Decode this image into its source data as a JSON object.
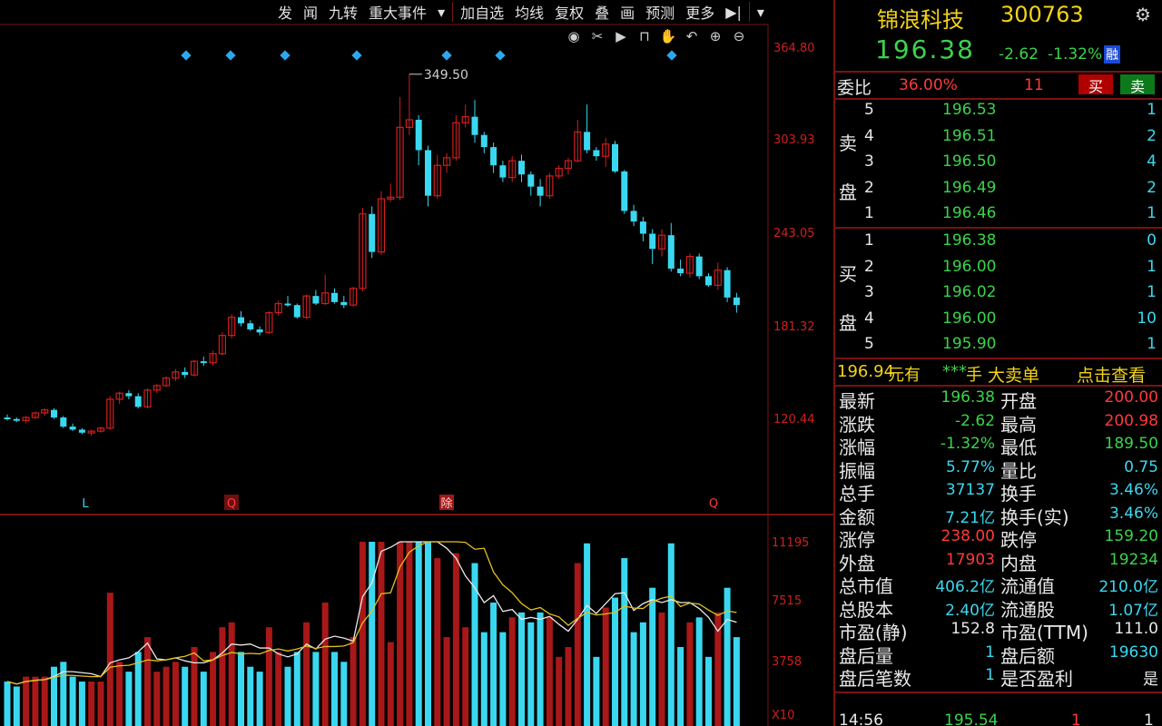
{
  "toolbar": {
    "items": [
      "发",
      "闻",
      "九转",
      "重大事件",
      "▾",
      "加自选",
      "均线",
      "复权",
      "叠",
      "画",
      "预测",
      "更多",
      "▶|",
      "▾"
    ]
  },
  "tool_icons": [
    "eye-icon",
    "scissors-icon",
    "play-icon",
    "lock-icon",
    "hand-icon",
    "undo-icon",
    "zoom-in-icon",
    "zoom-out-icon"
  ],
  "chart": {
    "price_axis": [
      "364.80",
      "303.93",
      "243.05",
      "181.32",
      "120.44"
    ],
    "volume_axis": [
      "11195",
      "7515",
      "3758",
      "X10"
    ],
    "peak_label": "349.50",
    "markers": [
      "L",
      "Q",
      "除",
      "Q"
    ]
  },
  "chart_data": {
    "type": "candlestick",
    "candles": [
      [
        124,
        126,
        122,
        123
      ],
      [
        123,
        124,
        121,
        122
      ],
      [
        122,
        125,
        120,
        124
      ],
      [
        124,
        128,
        123,
        127
      ],
      [
        127,
        130,
        125,
        129
      ],
      [
        129,
        130,
        123,
        124
      ],
      [
        124,
        125,
        117,
        118
      ],
      [
        118,
        120,
        115,
        116
      ],
      [
        116,
        117,
        113,
        114
      ],
      [
        114,
        116,
        112,
        115
      ],
      [
        115,
        118,
        114,
        117
      ],
      [
        117,
        138,
        116,
        136
      ],
      [
        136,
        141,
        133,
        140
      ],
      [
        140,
        142,
        136,
        138
      ],
      [
        138,
        140,
        130,
        131
      ],
      [
        131,
        143,
        130,
        142
      ],
      [
        142,
        146,
        140,
        145
      ],
      [
        145,
        151,
        144,
        150
      ],
      [
        150,
        156,
        148,
        154
      ],
      [
        154,
        157,
        150,
        152
      ],
      [
        152,
        162,
        151,
        161
      ],
      [
        161,
        164,
        158,
        160
      ],
      [
        160,
        168,
        158,
        166
      ],
      [
        166,
        180,
        165,
        178
      ],
      [
        178,
        192,
        176,
        190
      ],
      [
        190,
        194,
        184,
        186
      ],
      [
        186,
        188,
        181,
        182
      ],
      [
        182,
        184,
        178,
        180
      ],
      [
        180,
        194,
        179,
        193
      ],
      [
        193,
        201,
        191,
        199
      ],
      [
        199,
        204,
        197,
        198
      ],
      [
        198,
        199,
        189,
        190
      ],
      [
        190,
        205,
        189,
        204
      ],
      [
        204,
        208,
        198,
        199
      ],
      [
        199,
        218,
        198,
        206
      ],
      [
        206,
        209,
        199,
        200
      ],
      [
        200,
        204,
        196,
        198
      ],
      [
        198,
        210,
        197,
        209
      ],
      [
        209,
        262,
        207,
        258
      ],
      [
        258,
        263,
        229,
        233
      ],
      [
        233,
        273,
        231,
        268
      ],
      [
        268,
        278,
        266,
        269
      ],
      [
        269,
        335,
        267,
        315
      ],
      [
        315,
        350,
        310,
        320
      ],
      [
        320,
        323,
        290,
        300
      ],
      [
        300,
        303,
        263,
        270
      ],
      [
        270,
        297,
        268,
        290
      ],
      [
        290,
        298,
        285,
        295
      ],
      [
        295,
        323,
        293,
        318
      ],
      [
        318,
        330,
        315,
        322
      ],
      [
        322,
        333,
        305,
        310
      ],
      [
        310,
        312,
        298,
        302
      ],
      [
        302,
        305,
        285,
        290
      ],
      [
        290,
        293,
        279,
        282
      ],
      [
        282,
        296,
        279,
        293
      ],
      [
        293,
        297,
        279,
        284
      ],
      [
        284,
        286,
        270,
        276
      ],
      [
        276,
        281,
        263,
        270
      ],
      [
        270,
        285,
        268,
        283
      ],
      [
        283,
        290,
        281,
        288
      ],
      [
        288,
        295,
        284,
        293
      ],
      [
        293,
        320,
        292,
        312
      ],
      [
        312,
        330,
        298,
        300
      ],
      [
        300,
        302,
        293,
        296
      ],
      [
        296,
        308,
        289,
        304
      ],
      [
        304,
        306,
        285,
        286
      ],
      [
        286,
        287,
        258,
        260
      ],
      [
        260,
        264,
        250,
        253
      ],
      [
        253,
        256,
        240,
        245
      ],
      [
        245,
        248,
        225,
        235
      ],
      [
        235,
        248,
        230,
        244
      ],
      [
        244,
        252,
        220,
        222
      ],
      [
        222,
        228,
        217,
        219
      ],
      [
        219,
        232,
        216,
        230
      ],
      [
        230,
        232,
        215,
        217
      ],
      [
        217,
        219,
        210,
        211
      ],
      [
        211,
        226,
        208,
        221
      ],
      [
        221,
        223,
        200,
        203
      ],
      [
        203,
        206,
        193,
        198
      ]
    ]
  },
  "quote": {
    "name": "锦浪科技",
    "code": "300763",
    "price": "196.38",
    "change": "-2.62",
    "change_pct": "-1.32%",
    "tag": "融",
    "weibi_label": "委比",
    "weibi_value": "36.00%",
    "weibi_diff": "11",
    "buy_btn": "买",
    "sell_btn": "卖"
  },
  "sell_orders": [
    {
      "level": "5",
      "price": "196.53",
      "vol": "1"
    },
    {
      "level": "4",
      "price": "196.51",
      "vol": "2"
    },
    {
      "level": "3",
      "price": "196.50",
      "vol": "4"
    },
    {
      "level": "2",
      "price": "196.49",
      "vol": "2"
    },
    {
      "level": "1",
      "price": "196.46",
      "vol": "1"
    }
  ],
  "buy_orders": [
    {
      "level": "1",
      "price": "196.38",
      "vol": "0"
    },
    {
      "level": "2",
      "price": "196.00",
      "vol": "1"
    },
    {
      "level": "3",
      "price": "196.02",
      "vol": "1"
    },
    {
      "level": "4",
      "price": "196.00",
      "vol": "10"
    },
    {
      "level": "5",
      "price": "195.90",
      "vol": "1"
    }
  ],
  "side_labels": {
    "sell1": "卖",
    "sell2": "盘",
    "buy1": "买",
    "buy2": "盘"
  },
  "big_order": {
    "price": "196.94",
    "text1": "元有",
    "stars": "***",
    "text2": "手",
    "title": "大卖单",
    "link": "点击查看"
  },
  "stats": [
    {
      "l": "最新",
      "v": "196.38",
      "vc": "green",
      "l2": "开盘",
      "v2": "200.00",
      "vc2": "red"
    },
    {
      "l": "涨跌",
      "v": "-2.62",
      "vc": "green",
      "l2": "最高",
      "v2": "200.98",
      "vc2": "red"
    },
    {
      "l": "涨幅",
      "v": "-1.32%",
      "vc": "green",
      "l2": "最低",
      "v2": "189.50",
      "vc2": "green"
    },
    {
      "l": "振幅",
      "v": "5.77%",
      "vc": "cyan",
      "l2": "量比",
      "v2": "0.75",
      "vc2": "cyan"
    },
    {
      "l": "总手",
      "v": "37137",
      "vc": "cyan",
      "l2": "换手",
      "v2": "3.46%",
      "vc2": "cyan"
    },
    {
      "l": "金额",
      "v": "7.21亿",
      "vc": "cyan",
      "l2": "换手(实)",
      "v2": "3.46%",
      "vc2": "cyan"
    },
    {
      "l": "涨停",
      "v": "238.00",
      "vc": "red",
      "l2": "跌停",
      "v2": "159.20",
      "vc2": "green"
    },
    {
      "l": "外盘",
      "v": "17903",
      "vc": "red",
      "l2": "内盘",
      "v2": "19234",
      "vc2": "green"
    },
    {
      "l": "总市值",
      "v": "406.2亿",
      "vc": "cyan",
      "l2": "流通值",
      "v2": "210.0亿",
      "vc2": "cyan"
    },
    {
      "l": "总股本",
      "v": "2.40亿",
      "vc": "cyan",
      "l2": "流通股",
      "v2": "1.07亿",
      "vc2": "cyan"
    },
    {
      "l": "市盈(静)",
      "v": "152.8",
      "vc": "white",
      "l2": "市盈(TTM)",
      "v2": "111.0",
      "vc2": "white"
    },
    {
      "l": "盘后量",
      "v": "1",
      "vc": "cyan",
      "l2": "盘后额",
      "v2": "19630",
      "vc2": "cyan"
    },
    {
      "l": "盘后笔数",
      "v": "1",
      "vc": "cyan",
      "l2": "是否盈利",
      "v2": "是",
      "vc2": "white"
    }
  ],
  "tick": {
    "time": "14:56",
    "price": "195.54",
    "vol": "1",
    "flag": "1"
  },
  "colors": {
    "up": "#d21e1e",
    "down": "#3ad8f0",
    "grid": "#7a1212",
    "ma_white": "#e8e8e8",
    "ma_yellow": "#e0c020"
  }
}
